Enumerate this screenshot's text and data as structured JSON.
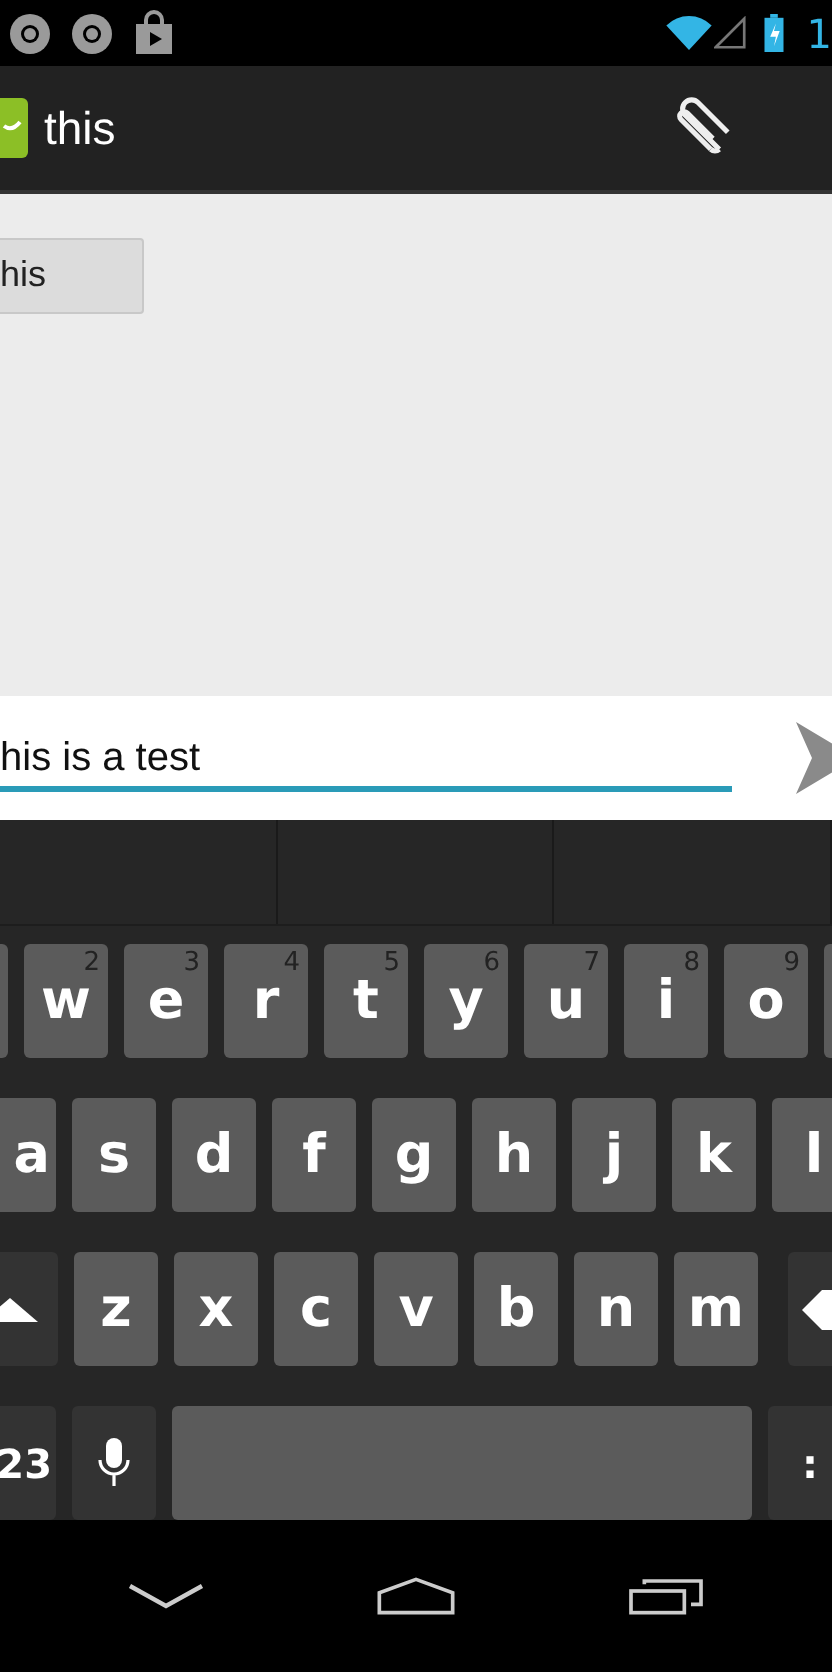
{
  "status_bar": {
    "time": "1"
  },
  "action_bar": {
    "title": "this"
  },
  "conversation": {
    "messages": [
      {
        "text": "his"
      }
    ]
  },
  "compose": {
    "value": "his is a test"
  },
  "keyboard": {
    "rows": [
      [
        {
          "kind": "letter"
        },
        {
          "kind": "letter",
          "label": "w",
          "hint": "2"
        },
        {
          "kind": "letter",
          "label": "e",
          "hint": "3"
        },
        {
          "kind": "letter",
          "label": "r",
          "hint": "4"
        },
        {
          "kind": "letter",
          "label": "t",
          "hint": "5"
        },
        {
          "kind": "letter",
          "label": "y",
          "hint": "6"
        },
        {
          "kind": "letter",
          "label": "u",
          "hint": "7"
        },
        {
          "kind": "letter",
          "label": "i",
          "hint": "8"
        },
        {
          "kind": "letter",
          "label": "o",
          "hint": "9"
        },
        {
          "kind": "letter"
        }
      ],
      [
        {
          "kind": "letter",
          "label": "a",
          "edge": true
        },
        {
          "kind": "letter",
          "label": "s"
        },
        {
          "kind": "letter",
          "label": "d"
        },
        {
          "kind": "letter",
          "label": "f"
        },
        {
          "kind": "letter",
          "label": "g"
        },
        {
          "kind": "letter",
          "label": "h"
        },
        {
          "kind": "letter",
          "label": "j"
        },
        {
          "kind": "letter",
          "label": "k"
        },
        {
          "kind": "letter",
          "label": "l"
        }
      ],
      [
        {
          "kind": "shift"
        },
        {
          "kind": "letter",
          "label": "z"
        },
        {
          "kind": "letter",
          "label": "x"
        },
        {
          "kind": "letter",
          "label": "c"
        },
        {
          "kind": "letter",
          "label": "v"
        },
        {
          "kind": "letter",
          "label": "b"
        },
        {
          "kind": "letter",
          "label": "n"
        },
        {
          "kind": "letter",
          "label": "m"
        },
        {
          "kind": "delete"
        }
      ],
      [
        {
          "kind": "function",
          "label": "23",
          "edge": true
        },
        {
          "kind": "mic"
        },
        {
          "kind": "space"
        },
        {
          "kind": "function",
          "label": ":"
        }
      ]
    ]
  }
}
